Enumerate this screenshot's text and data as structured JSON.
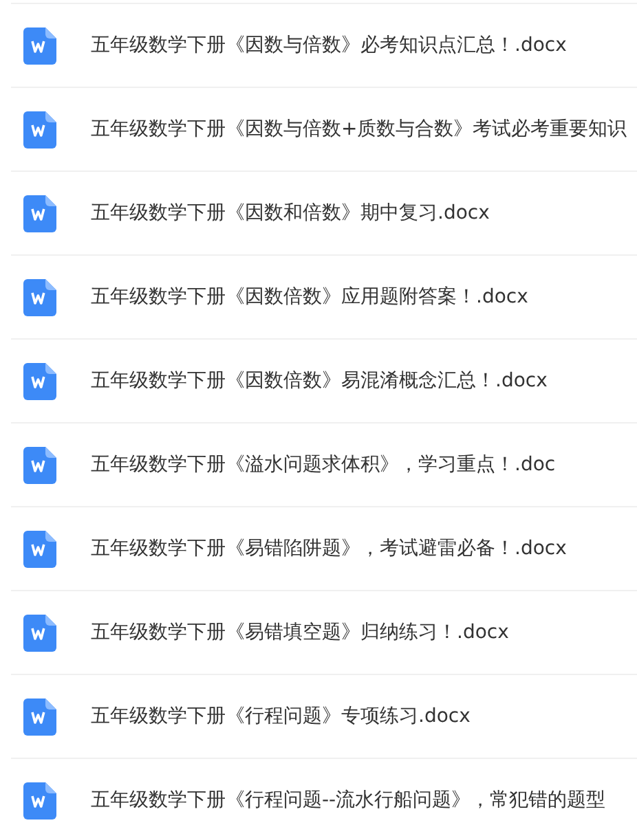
{
  "files": [
    {
      "name": "五年级数学下册《因数与倍数》必考知识点汇总！.docx"
    },
    {
      "name": "五年级数学下册《因数与倍数+质数与合数》考试必考重要知识"
    },
    {
      "name": "五年级数学下册《因数和倍数》期中复习.docx"
    },
    {
      "name": "五年级数学下册《因数倍数》应用题附答案！.docx"
    },
    {
      "name": "五年级数学下册《因数倍数》易混淆概念汇总！.docx"
    },
    {
      "name": "五年级数学下册《溢水问题求体积》，学习重点！.doc"
    },
    {
      "name": "五年级数学下册《易错陷阱题》，考试避雷必备！.docx"
    },
    {
      "name": "五年级数学下册《易错填空题》归纳练习！.docx"
    },
    {
      "name": "五年级数学下册《行程问题》专项练习.docx"
    },
    {
      "name": "五年级数学下册《行程问题--流水行船问题》，常犯错的题型"
    }
  ]
}
